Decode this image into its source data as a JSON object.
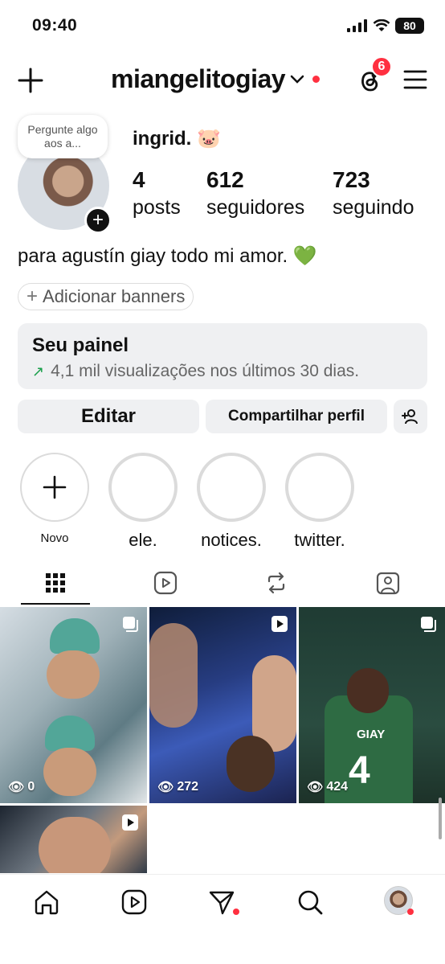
{
  "status_bar": {
    "time": "09:40",
    "battery": "80"
  },
  "header": {
    "username": "miangelitogiay",
    "threads_badge": "6"
  },
  "profile": {
    "note": "Pergunte algo aos a...",
    "display_name": "ingrid. 🐷",
    "stats": [
      {
        "value": "4",
        "label": "posts"
      },
      {
        "value": "612",
        "label": "seguidores"
      },
      {
        "value": "723",
        "label": "seguindo"
      }
    ],
    "bio": "para agustín giay todo mi amor. 💚",
    "banners_label": "Adicionar banners"
  },
  "dashboard": {
    "title": "Seu painel",
    "subtitle": "4,1 mil visualizações nos últimos 30 dias."
  },
  "actions": {
    "edit": "Editar",
    "share": "Compartilhar perfil"
  },
  "highlights": [
    {
      "label": "Novo"
    },
    {
      "label": "ele."
    },
    {
      "label": "notices."
    },
    {
      "label": "twitter."
    }
  ],
  "posts": [
    {
      "type": "carousel",
      "views": "0"
    },
    {
      "type": "reel",
      "views": "272"
    },
    {
      "type": "carousel",
      "views": "424",
      "jersey_name": "GIAY",
      "jersey_number": "4"
    },
    {
      "type": "reel"
    }
  ],
  "icons": {
    "header": [
      "plus-icon",
      "chevron-down-icon",
      "threads-icon",
      "hamburger-menu-icon"
    ],
    "tabs": [
      "grid-icon",
      "reels-icon",
      "reposts-icon",
      "tagged-icon"
    ],
    "nav": [
      "home-icon",
      "reels-icon",
      "send-icon",
      "search-icon",
      "profile-avatar"
    ]
  },
  "colors": {
    "badge_red": "#ff3040",
    "trend_green": "#1a9f4b",
    "button_gray": "#eff0f2"
  }
}
